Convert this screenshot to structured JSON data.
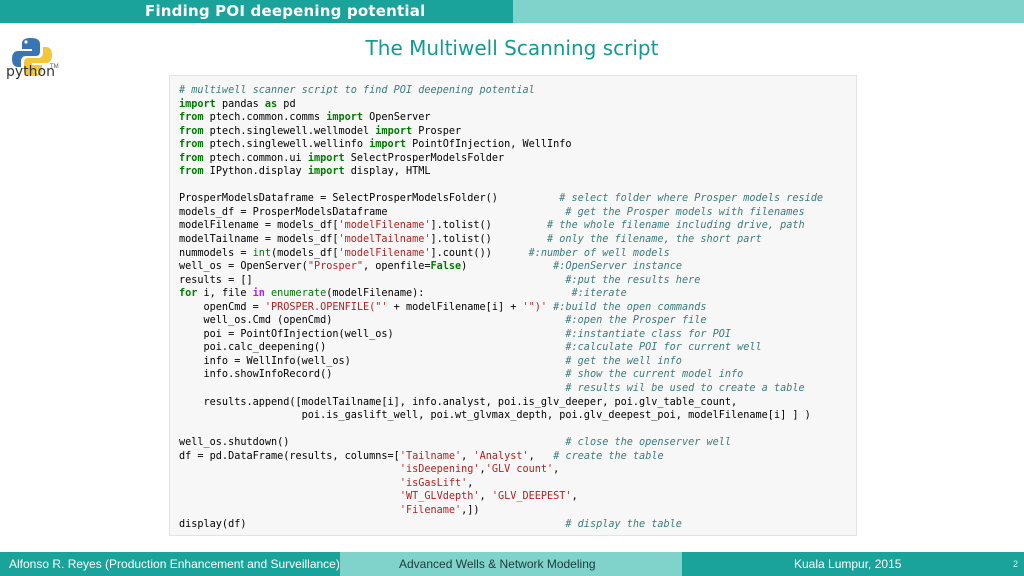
{
  "header": {
    "title": "Finding POI deepening potential"
  },
  "logo": {
    "text": "python",
    "tm": "TM"
  },
  "slide": {
    "title": "The Multiwell Scanning script"
  },
  "code": {
    "l01": "# multiwell scanner script to find POI deepening potential",
    "l02a": "import",
    "l02b": " pandas ",
    "l02c": "as",
    "l02d": " pd",
    "l03a": "from",
    "l03b": " ptech.common.comms ",
    "l03c": "import",
    "l03d": " OpenServer",
    "l04a": "from",
    "l04b": " ptech.singlewell.wellmodel ",
    "l04c": "import",
    "l04d": " Prosper",
    "l05a": "from",
    "l05b": " ptech.singlewell.wellinfo ",
    "l05c": "import",
    "l05d": " PointOfInjection, WellInfo",
    "l06a": "from",
    "l06b": " ptech.common.ui ",
    "l06c": "import",
    "l06d": " SelectProsperModelsFolder",
    "l07a": "from",
    "l07b": " IPython.display ",
    "l07c": "import",
    "l07d": " display, HTML",
    "l09a": "ProsperModelsDataframe = SelectProsperModelsFolder()          ",
    "l09c": "# select folder where Prosper models reside",
    "l10a": "models_df = ProsperModelsDataframe                             ",
    "l10c": "# get the Prosper models with filenames",
    "l11a": "modelFilename = models_df[",
    "l11b": "'modelFilename'",
    "l11d": "].tolist()         ",
    "l11c": "# the whole filename including drive, path",
    "l12a": "modelTailname = models_df[",
    "l12b": "'modelTailname'",
    "l12d": "].tolist()         ",
    "l12c": "# only the filename, the short part",
    "l13a": "nummodels = ",
    "l13k": "int",
    "l13b": "(models_df[",
    "l13s": "'modelFilename'",
    "l13d": "].count())      ",
    "l13c": "#:number of well models",
    "l14a": "well_os = OpenServer(",
    "l14s": "\"Prosper\"",
    "l14b": ", openfile=",
    "l14k": "False",
    "l14d": ")              ",
    "l14c": "#:OpenServer instance",
    "l15a": "results = []                                                   ",
    "l15c": "#:put the results here",
    "l16a": "for",
    "l16b": " i, file ",
    "l16c": "in",
    "l16k": " enumerate",
    "l16d": "(modelFilename):                        ",
    "l16e": "#:iterate",
    "l17a": "    openCmd = ",
    "l17s": "'PROSPER.OPENFILE(\"'",
    "l17b": " + modelFilename[i] + ",
    "l17t": "'\")'",
    "l17d": " ",
    "l17c": "#:build the open commands",
    "l18a": "    well_os.Cmd (openCmd)                                      ",
    "l18c": "#:open the Prosper file",
    "l19a": "    poi = PointOfInjection(well_os)                            ",
    "l19c": "#:instantiate class for POI",
    "l20a": "    poi.calc_deepening()                                       ",
    "l20c": "#:calculate POI for current well",
    "l21a": "    info = WellInfo(well_os)                                   ",
    "l21c": "# get the well info",
    "l22a": "    info.showInfoRecord()                                      ",
    "l22c": "# show the current model info",
    "l23a": "                                                               ",
    "l23c": "# results wil be used to create a table",
    "l24a": "    results.append([modelTailname[i], info.analyst, poi.is_glv_deeper, poi.glv_table_count,",
    "l25a": "                    poi.is_gaslift_well, poi.wt_glvmax_depth, poi.glv_deepest_poi, modelFilename[i] ] )",
    "l27a": "well_os.shutdown()                                             ",
    "l27c": "# close the openserver well",
    "l28a": "df = pd.DataFrame(results, columns=[",
    "l28s": "'Tailname'",
    "l28b": ", ",
    "l28t": "'Analyst'",
    "l28d": ",   ",
    "l28c": "# create the table",
    "l29a": "                                    ",
    "l29s": "'isDeepening'",
    "l29b": ",",
    "l29t": "'GLV count'",
    "l29d": ",",
    "l30a": "                                    ",
    "l30s": "'isGasLift'",
    "l30b": ",",
    "l31a": "                                    ",
    "l31s": "'WT_GLVdepth'",
    "l31b": ", ",
    "l31t": "'GLV_DEEPEST'",
    "l31d": ",",
    "l32a": "                                    ",
    "l32s": "'Filename'",
    "l32b": ",])",
    "l33a": "display(df)                                                    ",
    "l33c": "# display the table"
  },
  "footer": {
    "left": "Alfonso R. Reyes (Production Enhancement and Surveillance)",
    "center": "Advanced Wells & Network Modeling",
    "right": "Kuala Lumpur, 2015",
    "page": "2"
  }
}
